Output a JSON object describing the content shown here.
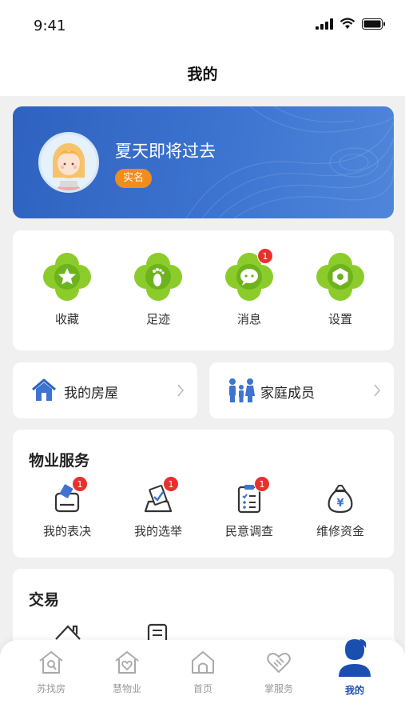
{
  "status_bar": {
    "time": "9:41"
  },
  "header": {
    "title": "我的"
  },
  "profile": {
    "username": "夏天即将过去",
    "badge": "实名"
  },
  "quick_actions": [
    {
      "label": "收藏",
      "icon": "star-icon"
    },
    {
      "label": "足迹",
      "icon": "footprint-icon"
    },
    {
      "label": "消息",
      "icon": "message-icon",
      "badge": "1"
    },
    {
      "label": "设置",
      "icon": "settings-icon"
    }
  ],
  "links": [
    {
      "label": "我的房屋",
      "icon": "house-icon"
    },
    {
      "label": "家庭成员",
      "icon": "family-icon"
    }
  ],
  "property_services": {
    "title": "物业服务",
    "items": [
      {
        "label": "我的表决",
        "icon": "vote-icon",
        "badge": "1"
      },
      {
        "label": "我的选举",
        "icon": "ballot-box-icon",
        "badge": "1"
      },
      {
        "label": "民意调查",
        "icon": "survey-clipboard-icon",
        "badge": "1"
      },
      {
        "label": "维修资金",
        "icon": "money-bag-icon"
      }
    ]
  },
  "trade": {
    "title": "交易"
  },
  "tabbar": [
    {
      "label": "苏找房",
      "icon": "house-search-icon"
    },
    {
      "label": "慧物业",
      "icon": "smart-property-icon"
    },
    {
      "label": "首页",
      "icon": "home-icon"
    },
    {
      "label": "掌服务",
      "icon": "handshake-icon"
    },
    {
      "label": "我的",
      "icon": "user-icon",
      "active": true
    }
  ],
  "colors": {
    "primary": "#2f62c0",
    "accent_green": "#8ccc2a",
    "badge_red": "#e8302d",
    "realname_orange": "#f18c1e"
  }
}
